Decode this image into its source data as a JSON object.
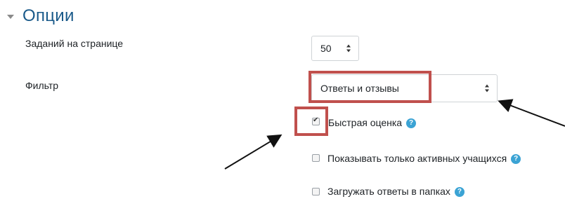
{
  "section": {
    "title": "Опции",
    "icon": "collapse-triangle-icon"
  },
  "per_page": {
    "label": "Заданий на странице",
    "value": "50"
  },
  "filter": {
    "label": "Фильтр",
    "value": "Ответы и отзывы"
  },
  "checkboxes": [
    {
      "label": "Быстрая оценка",
      "checked": true,
      "help": true
    },
    {
      "label": "Показывать только активных учащихся",
      "checked": false,
      "help": true
    },
    {
      "label": "Загружать ответы в папках",
      "checked": false,
      "help": true
    }
  ],
  "colors": {
    "title": "#1a5a8a",
    "highlight": "#c0504d",
    "help": "#3ba3d4"
  }
}
